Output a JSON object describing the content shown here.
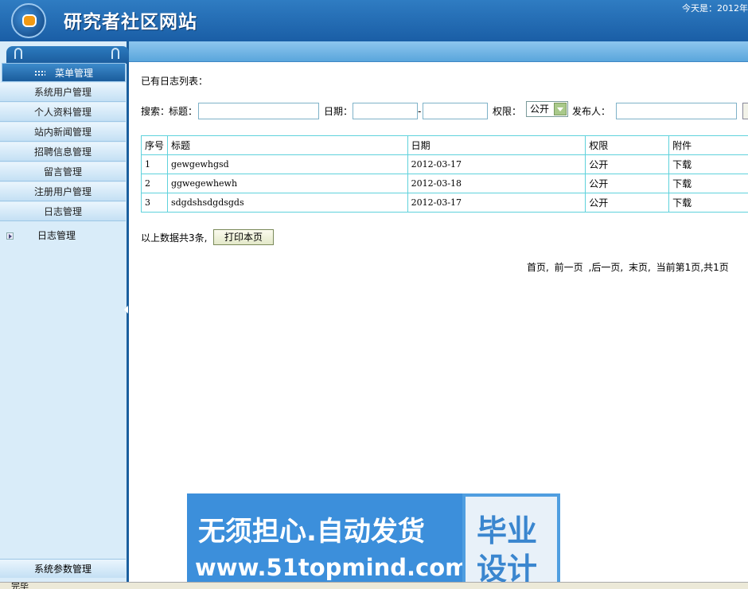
{
  "header": {
    "title": "研究者社区网站",
    "date_prefix": "今天是：2012年"
  },
  "sidebar": {
    "menu_title": "菜单管理",
    "items": [
      {
        "label": "系统用户管理"
      },
      {
        "label": "个人资料管理"
      },
      {
        "label": "站内新闻管理"
      },
      {
        "label": "招聘信息管理"
      },
      {
        "label": "留言管理"
      },
      {
        "label": "注册用户管理"
      },
      {
        "label": "日志管理"
      }
    ],
    "sub_item": "日志管理",
    "bottom_item": "系统参数管理"
  },
  "main": {
    "list_title": "已有日志列表：",
    "search": {
      "label": "搜索：",
      "title_label": "标题：",
      "title_value": "",
      "date_label": "日期：",
      "date_from": "",
      "date_sep": "-",
      "date_to": "",
      "permission_label": "权限：",
      "permission_selected": "公开",
      "publisher_label": "发布人：",
      "publisher_value": ""
    },
    "table": {
      "columns": [
        "序号",
        "标题",
        "日期",
        "权限",
        "附件"
      ],
      "rows": [
        {
          "no": "1",
          "title": "gewgewhgsd",
          "date": "2012-03-17",
          "permission": "公开",
          "attachment": "下载"
        },
        {
          "no": "2",
          "title": "ggwegewhewh",
          "date": "2012-03-18",
          "permission": "公开",
          "attachment": "下载"
        },
        {
          "no": "3",
          "title": "sdgdshsdgdsgds",
          "date": "2012-03-17",
          "permission": "公开",
          "attachment": "下载"
        }
      ]
    },
    "total_text": "以上数据共3条,",
    "print_button": "打印本页",
    "pager": {
      "first": "首页,",
      "prev": "前一页",
      "next": ",后一页,",
      "last": "末页,",
      "info": "当前第1页,共1页"
    }
  },
  "status_bar": {
    "text": "完毕"
  },
  "watermark": {
    "line1": "无须担心.自动发货",
    "line2": "www.51topmind.com",
    "right1": "毕业",
    "right2": "设计"
  },
  "colors": {
    "header": "#1a5ea6",
    "sidebar_bg": "#d9ecf9",
    "table_border": "#5fd2dc"
  }
}
